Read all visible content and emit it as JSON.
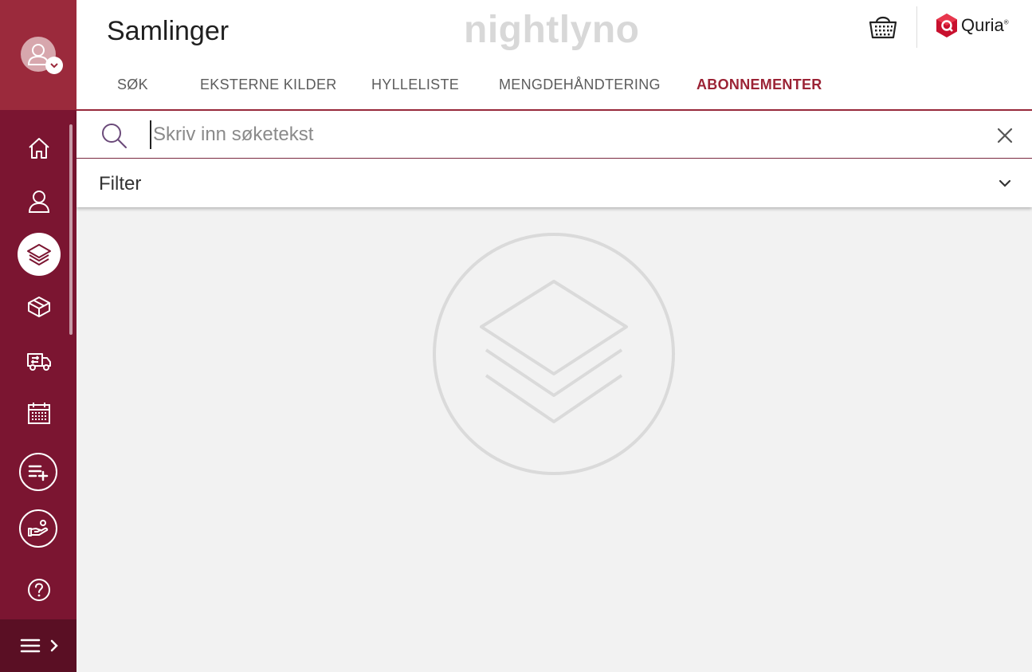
{
  "app": {
    "watermark": "nightlyno",
    "brand_name": "Quria",
    "brand_mark": "®",
    "accent_color": "#9b2335",
    "sidebar_color": "#7b1531"
  },
  "header": {
    "title": "Samlinger",
    "tabs": [
      {
        "label": "SØK",
        "active": false
      },
      {
        "label": "EKSTERNE KILDER",
        "active": false
      },
      {
        "label": "HYLLELISTE",
        "active": false
      },
      {
        "label": "MENGDEHÅNDTERING",
        "active": false
      },
      {
        "label": "ABONNEMENTER",
        "active": true
      }
    ]
  },
  "sidebar": {
    "items": [
      {
        "icon": "home-icon"
      },
      {
        "icon": "user-icon"
      },
      {
        "icon": "layers-icon",
        "active": true
      },
      {
        "icon": "box-icon"
      },
      {
        "icon": "truck-transfer-icon"
      },
      {
        "icon": "calendar-icon"
      },
      {
        "icon": "add-list-icon"
      },
      {
        "icon": "hand-give-icon"
      },
      {
        "icon": "help-icon"
      }
    ]
  },
  "search": {
    "placeholder": "Skriv inn søketekst",
    "value": ""
  },
  "filter": {
    "label": "Filter"
  }
}
